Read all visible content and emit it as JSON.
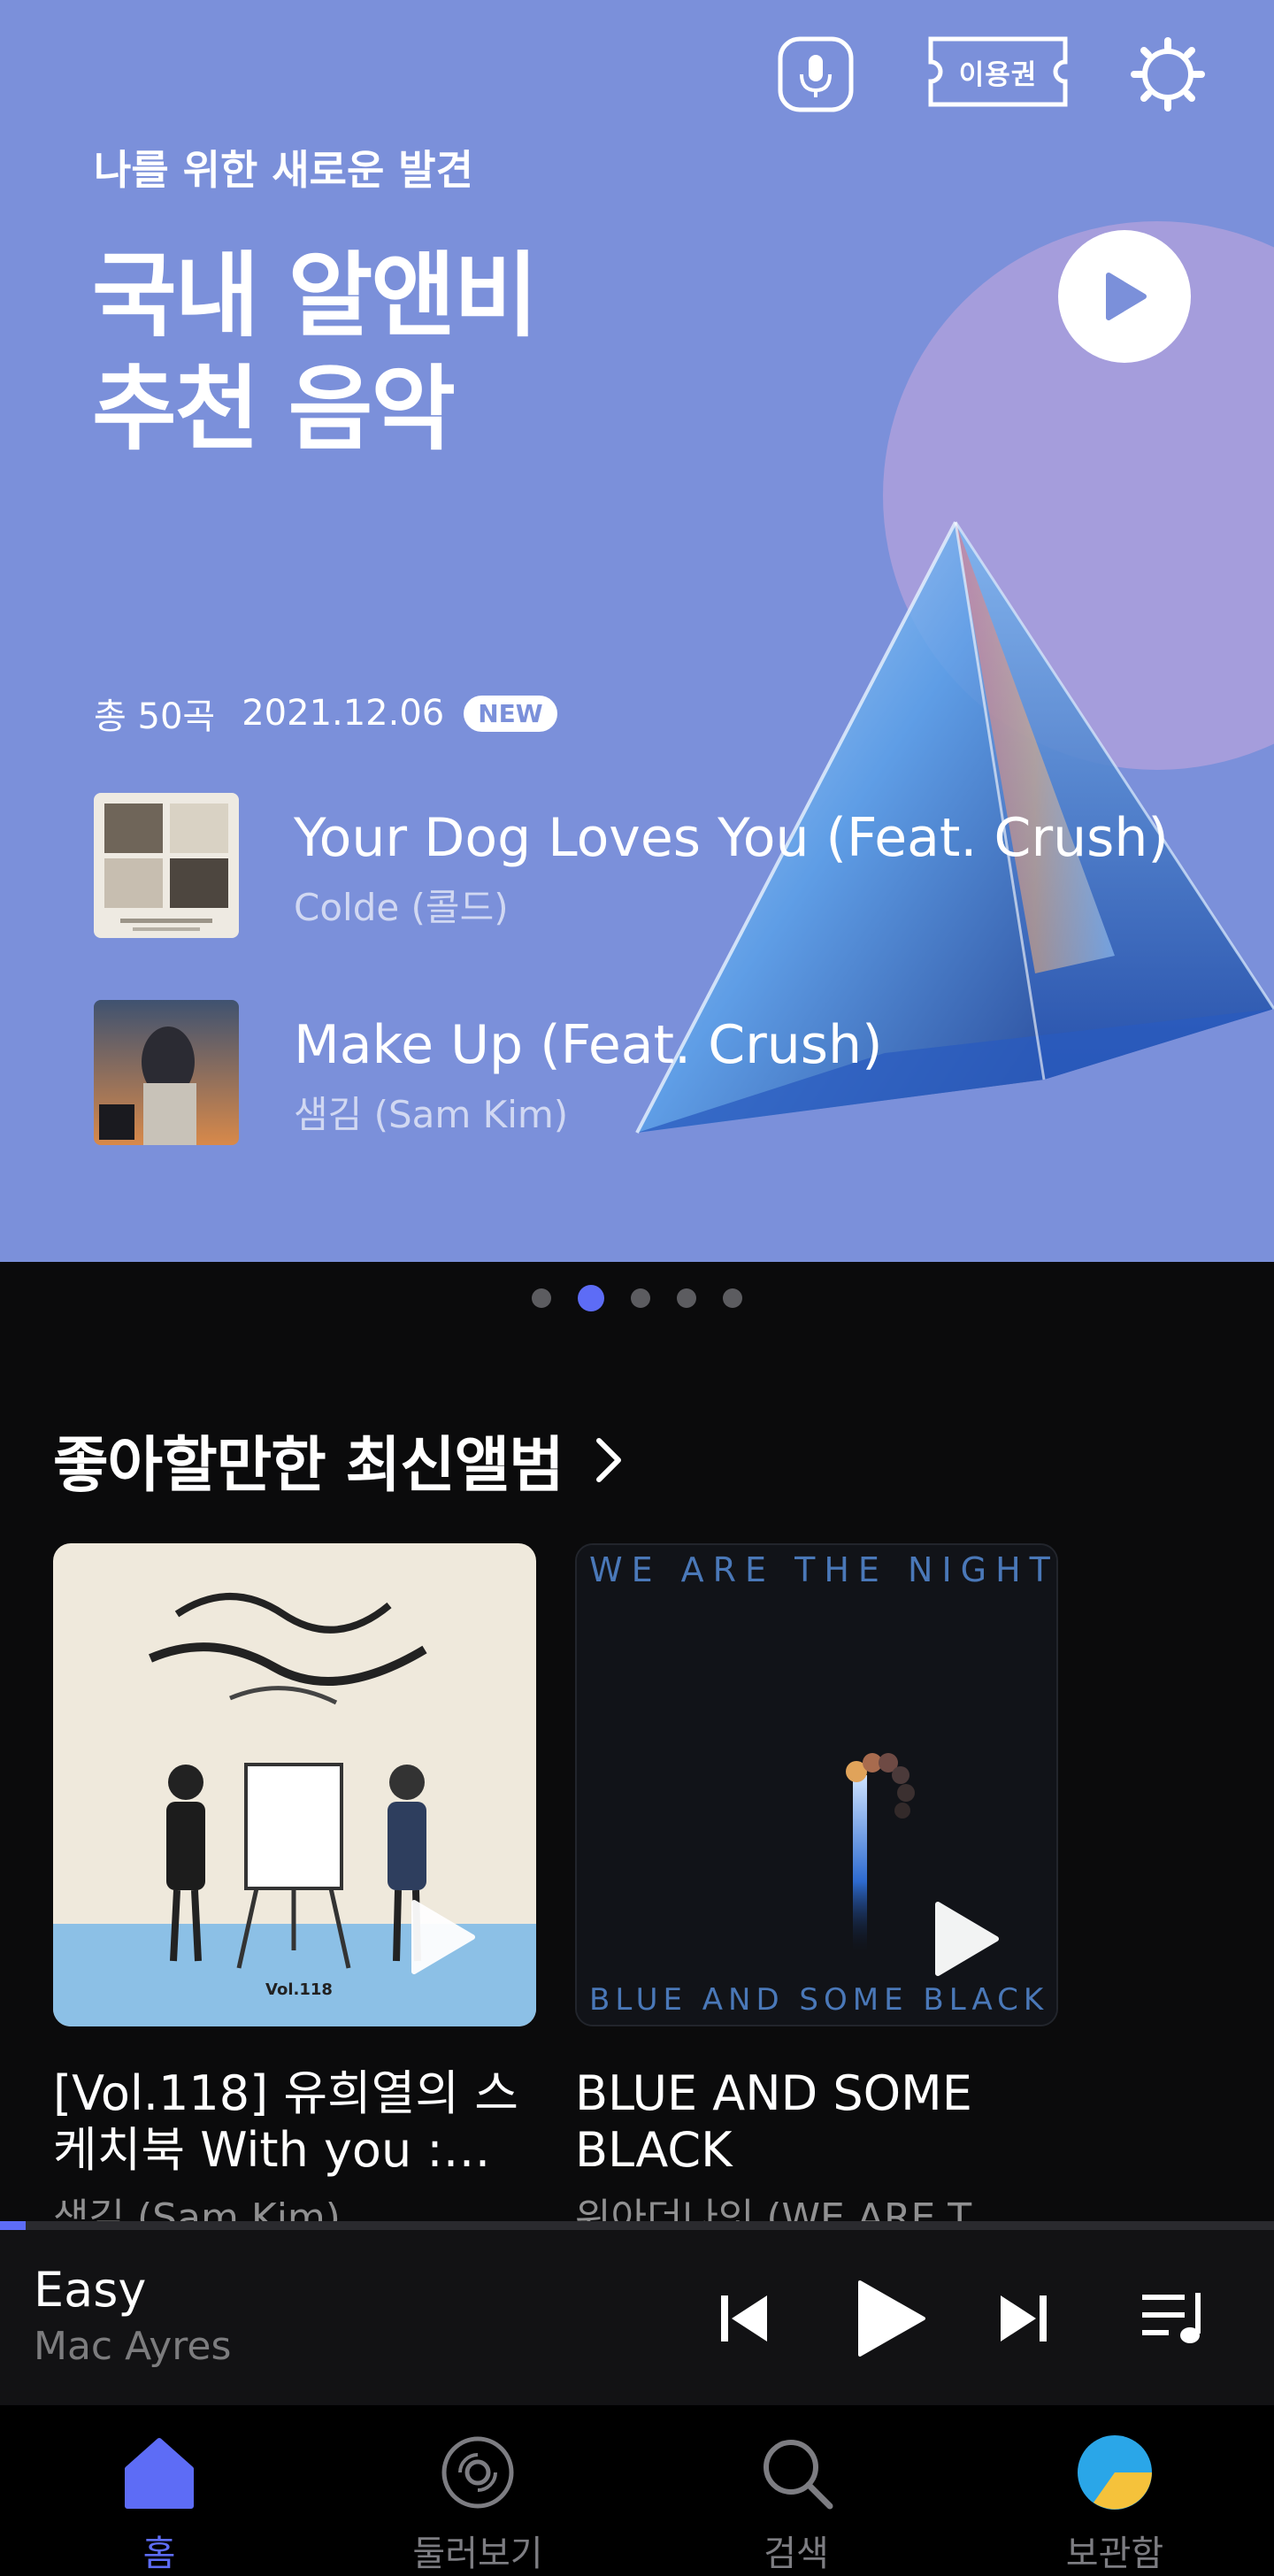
{
  "hero": {
    "ticket_label": "이용권",
    "subtitle": "나를 위한 새로운 발견",
    "title_line1": "국내 알앤비",
    "title_line2": "추천 음악",
    "count": "총 50곡",
    "date": "2021.12.06",
    "badge": "NEW",
    "tracks": [
      {
        "title": "Your Dog Loves You (Feat. Crush)",
        "artist": "Colde (콜드)"
      },
      {
        "title": "Make Up (Feat. Crush)",
        "artist": "샘김 (Sam Kim)"
      }
    ]
  },
  "carousel": {
    "pages": 5,
    "active_index": 1
  },
  "albums_section": {
    "title": "좋아할만한 최신앨범",
    "albums": [
      {
        "title": "[Vol.118] 유희열의 스케치북 With you :…",
        "artist": "샘김 (Sam Kim)",
        "cover_vol": "Vol.118"
      },
      {
        "title": "BLUE AND SOME BLACK",
        "artist": "위아더나잇 (WE ARE T…",
        "cover_top": "WE ARE THE NIGHT",
        "cover_bottom": "BLUE AND SOME BLACK"
      }
    ]
  },
  "player": {
    "title": "Easy",
    "artist": "Mac Ayres",
    "progress": 0.02
  },
  "tabs": [
    {
      "label": "홈",
      "icon": "home-icon",
      "active": true
    },
    {
      "label": "둘러보기",
      "icon": "disc-icon",
      "active": false
    },
    {
      "label": "검색",
      "icon": "search-icon",
      "active": false
    },
    {
      "label": "보관함",
      "icon": "library-icon",
      "active": false
    }
  ],
  "colors": {
    "hero_bg": "#7b90da",
    "accent": "#5d6cf6",
    "background": "#0b0b0c"
  }
}
